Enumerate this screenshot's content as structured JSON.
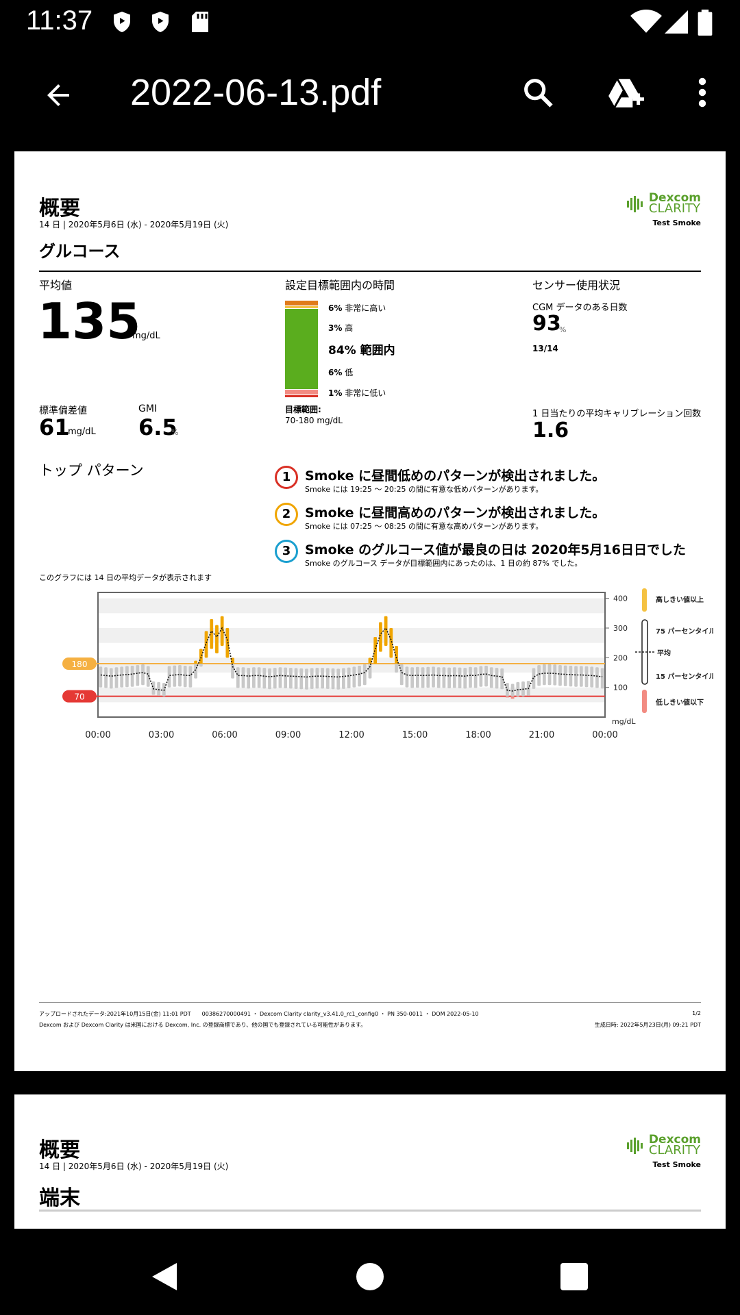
{
  "status_bar": {
    "time": "11:37"
  },
  "app_bar": {
    "title": "2022-06-13.pdf",
    "icons": [
      "back-arrow-icon",
      "search-icon",
      "drive-add-icon",
      "more-vert-icon"
    ]
  },
  "report": {
    "header": {
      "title": "概要",
      "date_range": "14 日 | 2020年5月6日 (水) - 2020年5月19日 (火)",
      "logo_line1": "Dexcom",
      "logo_line2": "CLARITY",
      "user": "Test Smoke"
    },
    "section_title": "グルコース",
    "average": {
      "label": "平均値",
      "value": "135",
      "unit": "mg/dL"
    },
    "sd": {
      "label": "標準偏差値",
      "value": "61",
      "unit": "mg/dL"
    },
    "gmi": {
      "label": "GMI",
      "value": "6.5",
      "unit": "%"
    },
    "time_in_range": {
      "label": "設定目標範囲内の時間",
      "rows": [
        {
          "pct": "6%",
          "text": "非常に高い",
          "fraction": 0.06,
          "color": "#e07b1a"
        },
        {
          "pct": "3%",
          "text": "高",
          "fraction": 0.03,
          "color": "#f5c242"
        },
        {
          "pct": "84%",
          "text": "範囲内",
          "fraction": 0.84,
          "color": "#5aad1e"
        },
        {
          "pct": "6%",
          "text": "低",
          "fraction": 0.06,
          "color": "#f28b82"
        },
        {
          "pct": "1%",
          "text": "非常に低い",
          "fraction": 0.01,
          "color": "#d93025"
        }
      ],
      "target_label": "目標範囲:",
      "target_value": "70-180 mg/dL"
    },
    "sensor": {
      "label": "センサー使用状況",
      "cgm_label": "CGM データのある日数",
      "cgm_value": "93",
      "cgm_unit": "%",
      "days": "13/14",
      "calib_label": "1 日当たりの平均キャリブレーション回数",
      "calib_value": "1.6"
    },
    "patterns": {
      "title": "トップ パターン",
      "items": [
        {
          "num": "1",
          "title": "Smoke に昼間低めのパターンが検出されました。",
          "sub": "Smoke には 19:25 ～ 20:25 の間に有意な低めパターンがあります。",
          "color": "#d93025"
        },
        {
          "num": "2",
          "title": "Smoke に昼間高めのパターンが検出されました。",
          "sub": "Smoke には 07:25 ～ 08:25 の間に有意な高めパターンがあります。",
          "color": "#f0a500"
        },
        {
          "num": "3",
          "title": "Smoke のグルコース値が最良の日は 2020年5月16日日でした",
          "sub": "Smoke のグルコース データが目標範囲内にあったのは、1 日の約 87% でした。",
          "color": "#1a9fcf"
        }
      ]
    },
    "chart_caption": "このグラフには 14 日の平均データが表示されます",
    "chart_data": {
      "type": "bar",
      "x_ticks": [
        "00:00",
        "03:00",
        "06:00",
        "09:00",
        "12:00",
        "15:00",
        "18:00",
        "21:00",
        "00:00"
      ],
      "y_ticks": [
        "400",
        "300",
        "200",
        "100"
      ],
      "y_unit": "mg/dL",
      "ylim": [
        0,
        420
      ],
      "high_threshold": "180",
      "low_threshold": "70",
      "legend": [
        {
          "label": "高しきい値以上",
          "color": "#f5c242"
        },
        {
          "label": "75 パーセンタイル"
        },
        {
          "label": "平均"
        },
        {
          "label": "15 パーセンタイル"
        },
        {
          "label": "低しきい値以下",
          "color": "#f28b82"
        }
      ],
      "mean": [
        142,
        140,
        138,
        140,
        142,
        143,
        145,
        148,
        150,
        145,
        95,
        92,
        90,
        140,
        142,
        143,
        141,
        140,
        160,
        200,
        250,
        290,
        270,
        300,
        260,
        170,
        140,
        140,
        138,
        140,
        140,
        138,
        136,
        138,
        140,
        139,
        138,
        137,
        136,
        135,
        137,
        138,
        138,
        137,
        136,
        135,
        137,
        139,
        142,
        145,
        150,
        170,
        230,
        280,
        300,
        260,
        200,
        150,
        142,
        140,
        141,
        140,
        141,
        142,
        140,
        140,
        139,
        140,
        139,
        138,
        141,
        140,
        144,
        145,
        140,
        138,
        136,
        90,
        88,
        92,
        94,
        96,
        135,
        145,
        148,
        148,
        147,
        145,
        144,
        143,
        142,
        142,
        141,
        140,
        138,
        136
      ],
      "p75": [
        170,
        168,
        165,
        168,
        170,
        172,
        173,
        175,
        178,
        172,
        120,
        118,
        115,
        172,
        174,
        175,
        173,
        172,
        190,
        230,
        290,
        330,
        310,
        340,
        300,
        200,
        168,
        168,
        166,
        168,
        168,
        166,
        164,
        166,
        168,
        167,
        166,
        165,
        164,
        163,
        165,
        166,
        166,
        165,
        164,
        163,
        165,
        167,
        170,
        173,
        178,
        200,
        270,
        320,
        340,
        300,
        240,
        178,
        170,
        168,
        169,
        168,
        169,
        170,
        168,
        168,
        167,
        168,
        167,
        166,
        169,
        168,
        172,
        173,
        168,
        166,
        164,
        115,
        112,
        118,
        120,
        122,
        165,
        175,
        178,
        178,
        177,
        175,
        174,
        173,
        172,
        172,
        171,
        170,
        168,
        165
      ],
      "p15": [
        100,
        98,
        96,
        98,
        100,
        101,
        102,
        105,
        108,
        102,
        75,
        72,
        70,
        100,
        102,
        103,
        101,
        100,
        130,
        170,
        200,
        230,
        215,
        240,
        200,
        130,
        98,
        98,
        96,
        98,
        98,
        96,
        94,
        96,
        98,
        97,
        96,
        95,
        94,
        93,
        95,
        96,
        96,
        95,
        94,
        93,
        95,
        97,
        100,
        103,
        108,
        130,
        180,
        220,
        240,
        200,
        150,
        108,
        100,
        98,
        99,
        98,
        99,
        100,
        98,
        98,
        97,
        98,
        97,
        96,
        99,
        98,
        102,
        103,
        98,
        96,
        94,
        66,
        62,
        68,
        70,
        72,
        95,
        105,
        108,
        108,
        107,
        105,
        104,
        103,
        102,
        102,
        101,
        100,
        98,
        96
      ]
    },
    "footer": {
      "line1": "アップロードされたデータ:2021年10月15日(金) 11:01 PDT　　00386270000491 ・ Dexcom Clarity clarity_v3.41.0_rc1_config0 ・ PN 350-0011 ・ DOM 2022-05-10",
      "page": "1/2",
      "line2": "Dexcom および Dexcom Clarity は米国における Dexcom, Inc. の登録商標であり、他の国でも登録されている可能性があります。",
      "generated": "生成日時: 2022年5月23日(月) 09:21 PDT"
    }
  },
  "page2": {
    "title": "概要",
    "date_range": "14 日 | 2020年5月6日 (水) - 2020年5月19日 (火)",
    "logo_line1": "Dexcom",
    "logo_line2": "CLARITY",
    "user": "Test Smoke",
    "section_title": "端末"
  }
}
